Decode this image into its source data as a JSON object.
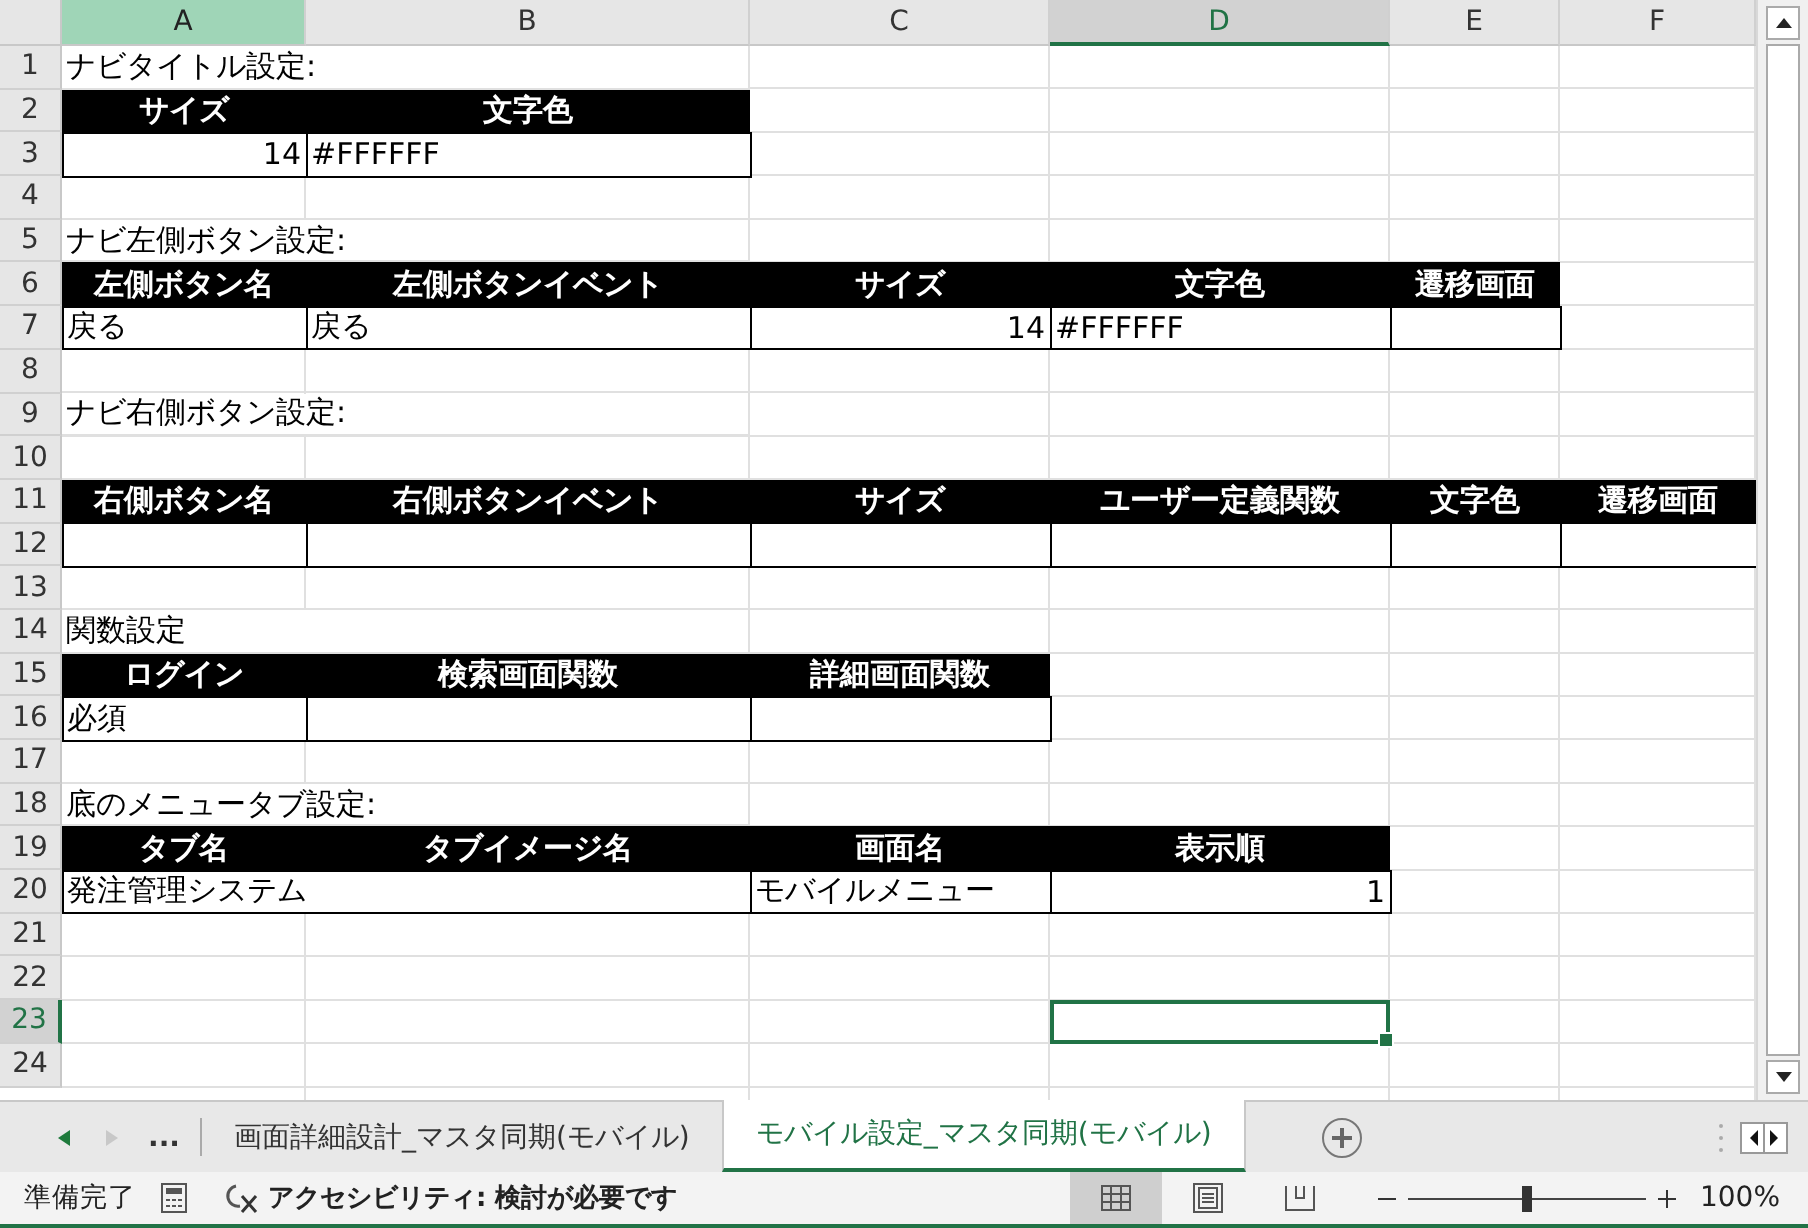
{
  "sheet": {
    "columns": [
      {
        "label": "A",
        "highlighted": true,
        "selected": false
      },
      {
        "label": "B",
        "highlighted": false,
        "selected": false
      },
      {
        "label": "C",
        "highlighted": false,
        "selected": false
      },
      {
        "label": "D",
        "highlighted": false,
        "selected": true
      },
      {
        "label": "E",
        "highlighted": false,
        "selected": false
      },
      {
        "label": "F",
        "highlighted": false,
        "selected": false
      }
    ],
    "rows": [
      {
        "label": "1",
        "selected": false,
        "cells": [
          {
            "kind": "label",
            "text": "ナビタイトル設定:"
          }
        ]
      },
      {
        "label": "2",
        "selected": false,
        "cells": [
          {
            "kind": "header",
            "text": "サイズ"
          },
          {
            "kind": "header",
            "text": "文字色"
          }
        ]
      },
      {
        "label": "3",
        "selected": false,
        "cells": [
          {
            "kind": "number",
            "text": "14"
          },
          {
            "kind": "value",
            "text": "#FFFFFF"
          }
        ]
      },
      {
        "label": "4",
        "selected": false,
        "cells": []
      },
      {
        "label": "5",
        "selected": false,
        "cells": [
          {
            "kind": "label",
            "text": "ナビ左側ボタン設定:"
          }
        ]
      },
      {
        "label": "6",
        "selected": false,
        "cells": [
          {
            "kind": "header",
            "text": "左側ボタン名"
          },
          {
            "kind": "header",
            "text": "左側ボタンイベント"
          },
          {
            "kind": "header",
            "text": "サイズ"
          },
          {
            "kind": "header",
            "text": "文字色"
          },
          {
            "kind": "header",
            "text": "遷移画面"
          }
        ]
      },
      {
        "label": "7",
        "selected": false,
        "cells": [
          {
            "kind": "value",
            "text": "戻る"
          },
          {
            "kind": "value",
            "text": "戻る"
          },
          {
            "kind": "number",
            "text": "14"
          },
          {
            "kind": "value",
            "text": "#FFFFFF"
          },
          {
            "kind": "value"
          }
        ]
      },
      {
        "label": "8",
        "selected": false,
        "cells": []
      },
      {
        "label": "9",
        "selected": false,
        "cells": [
          {
            "kind": "label",
            "text": "ナビ右側ボタン設定:"
          }
        ]
      },
      {
        "label": "10",
        "selected": false,
        "cells": []
      },
      {
        "label": "11",
        "selected": false,
        "cells": [
          {
            "kind": "header",
            "text": "右側ボタン名"
          },
          {
            "kind": "header",
            "text": "右側ボタンイベント"
          },
          {
            "kind": "header",
            "text": "サイズ"
          },
          {
            "kind": "header",
            "text": "ユーザー定義関数"
          },
          {
            "kind": "header",
            "text": "文字色"
          },
          {
            "kind": "header",
            "text": "遷移画面"
          }
        ]
      },
      {
        "label": "12",
        "selected": false,
        "cells": [
          {
            "kind": "value"
          },
          {
            "kind": "value"
          },
          {
            "kind": "value"
          },
          {
            "kind": "value"
          },
          {
            "kind": "value"
          },
          {
            "kind": "value"
          }
        ]
      },
      {
        "label": "13",
        "selected": false,
        "cells": []
      },
      {
        "label": "14",
        "selected": false,
        "cells": [
          {
            "kind": "label",
            "text": "関数設定"
          }
        ]
      },
      {
        "label": "15",
        "selected": false,
        "cells": [
          {
            "kind": "header",
            "text": "ログイン"
          },
          {
            "kind": "header",
            "text": "検索画面関数"
          },
          {
            "kind": "header",
            "text": "詳細画面関数"
          }
        ]
      },
      {
        "label": "16",
        "selected": false,
        "cells": [
          {
            "kind": "value",
            "text": "必須"
          },
          {
            "kind": "value"
          },
          {
            "kind": "value"
          }
        ]
      },
      {
        "label": "17",
        "selected": false,
        "cells": []
      },
      {
        "label": "18",
        "selected": false,
        "cells": [
          {
            "kind": "label",
            "text": "底のメニュータブ設定:"
          }
        ]
      },
      {
        "label": "19",
        "selected": false,
        "cells": [
          {
            "kind": "header",
            "text": "タブ名"
          },
          {
            "kind": "header",
            "text": "タブイメージ名"
          },
          {
            "kind": "header",
            "text": "画面名"
          },
          {
            "kind": "header",
            "text": "表示順"
          }
        ]
      },
      {
        "label": "20",
        "selected": false,
        "cells": [
          {
            "kind": "merged",
            "text": "発注管理システム"
          },
          {
            "kind": "covered"
          },
          {
            "kind": "value",
            "text": "モバイルメニュー"
          },
          {
            "kind": "number",
            "text": "1"
          }
        ]
      },
      {
        "label": "21",
        "selected": false,
        "cells": []
      },
      {
        "label": "22",
        "selected": false,
        "cells": []
      },
      {
        "label": "23",
        "selected": true,
        "cells": [
          {
            "kind": "plain"
          },
          {
            "kind": "plain"
          },
          {
            "kind": "plain"
          },
          {
            "kind": "active"
          }
        ]
      },
      {
        "label": "24",
        "selected": false,
        "cells": []
      }
    ]
  },
  "sheet_tabs": {
    "more": "...",
    "tabs": [
      {
        "label": "画面詳細設計_マスタ同期(モバイル)",
        "selected": false
      },
      {
        "label": "モバイル設定_マスタ同期(モバイル)",
        "selected": true
      }
    ]
  },
  "status_bar": {
    "status": "準備完了",
    "accessibility": "アクセシビリティ: 検討が必要です",
    "views": [
      {
        "kind": "normal",
        "selected": true
      },
      {
        "kind": "page-layout",
        "selected": false
      },
      {
        "kind": "page-break",
        "selected": false
      }
    ],
    "zoom": {
      "level": 0.5,
      "reading": "100%"
    }
  }
}
